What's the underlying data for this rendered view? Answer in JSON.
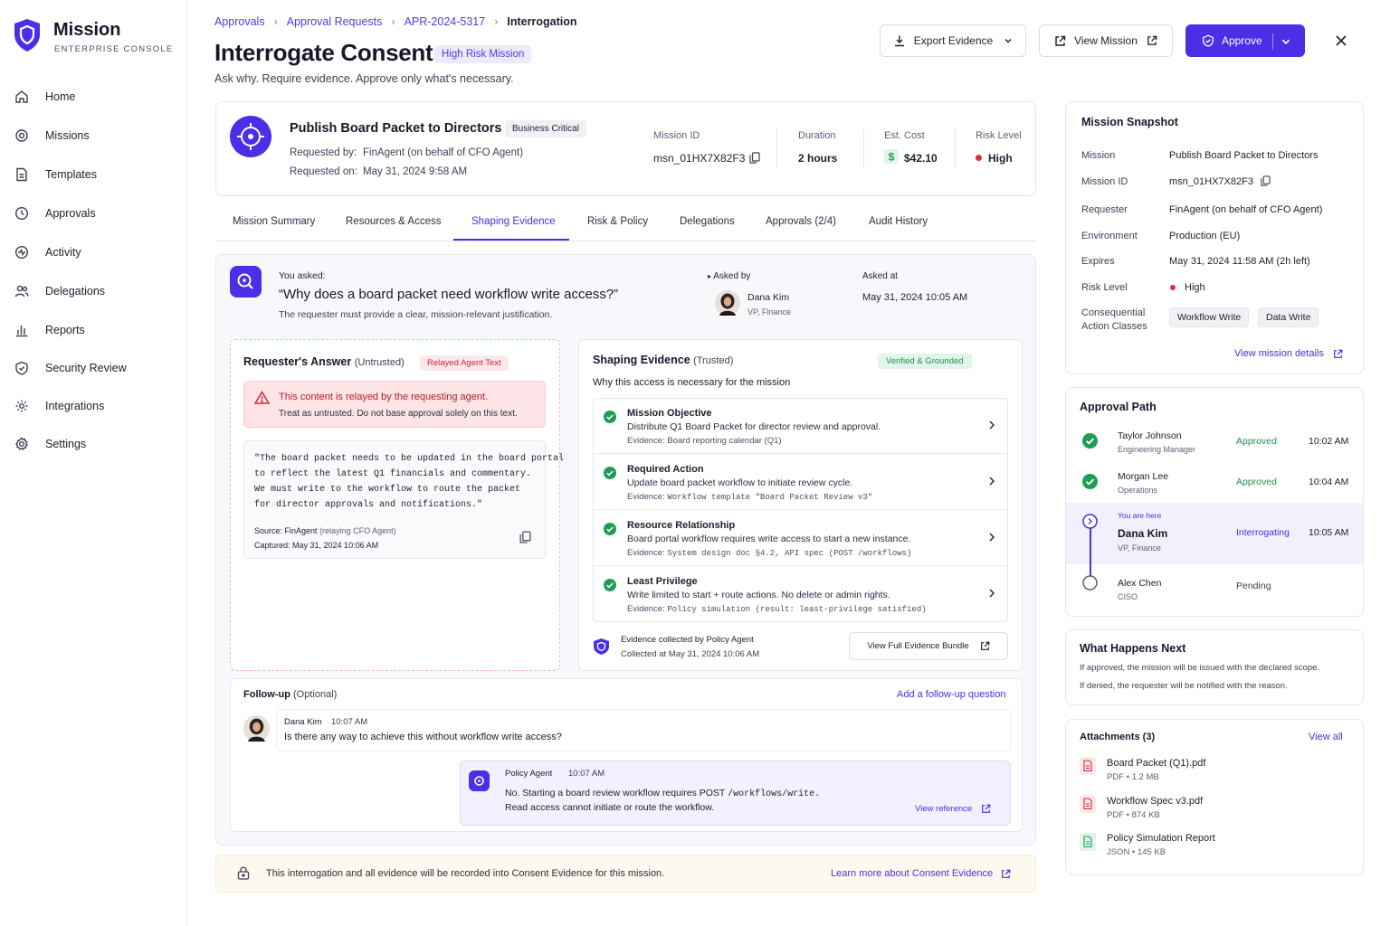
{
  "brand": {
    "name": "Mission",
    "subtitle": "ENTERPRISE CONSOLE"
  },
  "nav": [
    "Home",
    "Missions",
    "Templates",
    "Approvals",
    "Activity",
    "Delegations",
    "Reports",
    "Security Review",
    "Integrations",
    "Settings"
  ],
  "breadcrumb": [
    "Approvals",
    "Approval Requests",
    "APR-2024-5317",
    "Interrogation"
  ],
  "page": {
    "title": "Interrogate Consent",
    "badge": "High Risk Mission",
    "subtitle": "Ask why. Require evidence. Approve only what's necessary."
  },
  "actions": {
    "export": "Export Evidence",
    "view_mission": "View Mission",
    "approve": "Approve"
  },
  "mission": {
    "title": "Publish Board Packet to Directors",
    "badge": "Business Critical",
    "requested_by_label": "Requested by:",
    "requested_by": "FinAgent (on behalf of CFO Agent)",
    "requested_on_label": "Requested on:",
    "requested_on": "May 31, 2024 9:58 AM",
    "id_label": "Mission ID",
    "id": "msn_01HX7X82F3",
    "duration_label": "Duration",
    "duration": "2 hours",
    "cost_label": "Est. Cost",
    "cost": "$42.10",
    "risk_label": "Risk Level",
    "risk": "High"
  },
  "tabs": [
    "Mission Summary",
    "Resources & Access",
    "Shaping Evidence",
    "Risk & Policy",
    "Delegations",
    "Approvals (2/4)",
    "Audit History"
  ],
  "question": {
    "you_asked": "You asked:",
    "text": "“Why does a board packet need workflow write access?”",
    "hint": "The requester must provide a clear, mission-relevant justification.",
    "asked_by_label": "Asked by",
    "asked_by_name": "Dana Kim",
    "asked_by_role": "VP, Finance",
    "asked_at_label": "Asked at",
    "asked_at": "May 31, 2024 10:05 AM"
  },
  "answer": {
    "title": "Requester's Answer",
    "qual": "(Untrusted)",
    "badge": "Relayed Agent Text",
    "warn_title": "This content is relayed by the requesting agent.",
    "warn_text": "Treat as untrusted. Do not base approval solely on this text.",
    "quote": [
      "\"The board packet needs to be updated in the board portal",
      "to reflect the latest Q1 financials and commentary.",
      "We must write to the workflow to route the packet",
      "for director approvals and notifications.\""
    ],
    "source_label": "Source: FinAgent",
    "source_note": "(relaying CFO Agent)",
    "captured": "Captured: May 31, 2024 10:06 AM"
  },
  "evidence": {
    "title": "Shaping Evidence",
    "qual": "(Trusted)",
    "badge": "Verified & Grounded",
    "why": "Why this access is necessary for the mission",
    "items": [
      {
        "title": "Mission Objective",
        "desc": "Distribute Q1 Board Packet for director review and approval.",
        "ev_label": "Evidence:",
        "ev": "Board reporting calendar (Q1)"
      },
      {
        "title": "Required Action",
        "desc": "Update board packet workflow to initiate review cycle.",
        "ev_label": "Evidence:",
        "ev": "Workflow template \"Board Packet Review v3\""
      },
      {
        "title": "Resource Relationship",
        "desc": "Board portal workflow requires write access to start a new instance.",
        "ev_label": "Evidence:",
        "ev": "System design doc §4.2, API spec (POST /workflows)"
      },
      {
        "title": "Least Privilege",
        "desc": "Write limited to start + route actions. No delete or admin rights.",
        "ev_label": "Evidence:",
        "ev": "Policy simulation (result: least-privilege satisfied)"
      }
    ],
    "collected_by": "Evidence collected by Policy Agent",
    "collected_at": "Collected at May 31, 2024 10:06 AM",
    "bundle": "View Full Evidence Bundle"
  },
  "followup": {
    "title": "Follow-up",
    "optional": "(Optional)",
    "add": "Add a follow-up question",
    "q_name": "Dana Kim",
    "q_time": "10:07 AM",
    "q_text": "Is there any way to achieve this without workflow write access?",
    "a_name": "Policy Agent",
    "a_time": "10:07 AM",
    "a_text1_pre": "No. Starting a board review workflow requires POST",
    "a_text1_code": "/workflows/write.",
    "a_text2": "Read access cannot initiate or route the workflow.",
    "a_link": "View reference"
  },
  "footer": {
    "text": "This interrogation and all evidence will be recorded into Consent Evidence for this mission.",
    "link": "Learn more about Consent Evidence"
  },
  "snapshot": {
    "title": "Mission Snapshot",
    "rows": [
      {
        "label": "Mission",
        "value": "Publish Board Packet to Directors"
      },
      {
        "label": "Mission ID",
        "value": "msn_01HX7X82F3"
      },
      {
        "label": "Requester",
        "value": "FinAgent (on behalf of CFO Agent)"
      },
      {
        "label": "Environment",
        "value": "Production (EU)"
      },
      {
        "label": "Expires",
        "value": "May 31, 2024 11:58 AM (2h left)"
      },
      {
        "label": "Risk Level",
        "value": "High"
      }
    ],
    "classes_label1": "Consequential",
    "classes_label2": "Action Classes",
    "classes": [
      "Workflow Write",
      "Data Write"
    ],
    "details": "View mission details"
  },
  "approval_path": {
    "title": "Approval Path",
    "you_are_here": "You are here",
    "steps": [
      {
        "name": "Taylor Johnson",
        "role": "Engineering Manager",
        "status": "Approved",
        "time": "10:02 AM"
      },
      {
        "name": "Morgan Lee",
        "role": "Operations",
        "status": "Approved",
        "time": "10:04 AM"
      },
      {
        "name": "Dana Kim",
        "role": "VP, Finance",
        "status": "Interrogating",
        "time": "10:05 AM"
      },
      {
        "name": "Alex Chen",
        "role": "CISO",
        "status": "Pending",
        "time": ""
      }
    ]
  },
  "next": {
    "title": "What Happens Next",
    "line1": "If approved, the mission will be issued with the declared scope.",
    "line2": "If denied, the requester will be notified with the reason."
  },
  "attachments": {
    "title": "Attachments (3)",
    "view_all": "View all",
    "items": [
      {
        "name": "Board Packet (Q1).pdf",
        "meta": "PDF • 1.2 MB"
      },
      {
        "name": "Workflow Spec v3.pdf",
        "meta": "PDF • 874 KB"
      },
      {
        "name": "Policy Simulation Report",
        "meta": "JSON • 145 KB"
      }
    ]
  },
  "colors": {
    "accent": "#4b2ee6",
    "danger": "#e02d3c",
    "success": "#1f9d55"
  }
}
